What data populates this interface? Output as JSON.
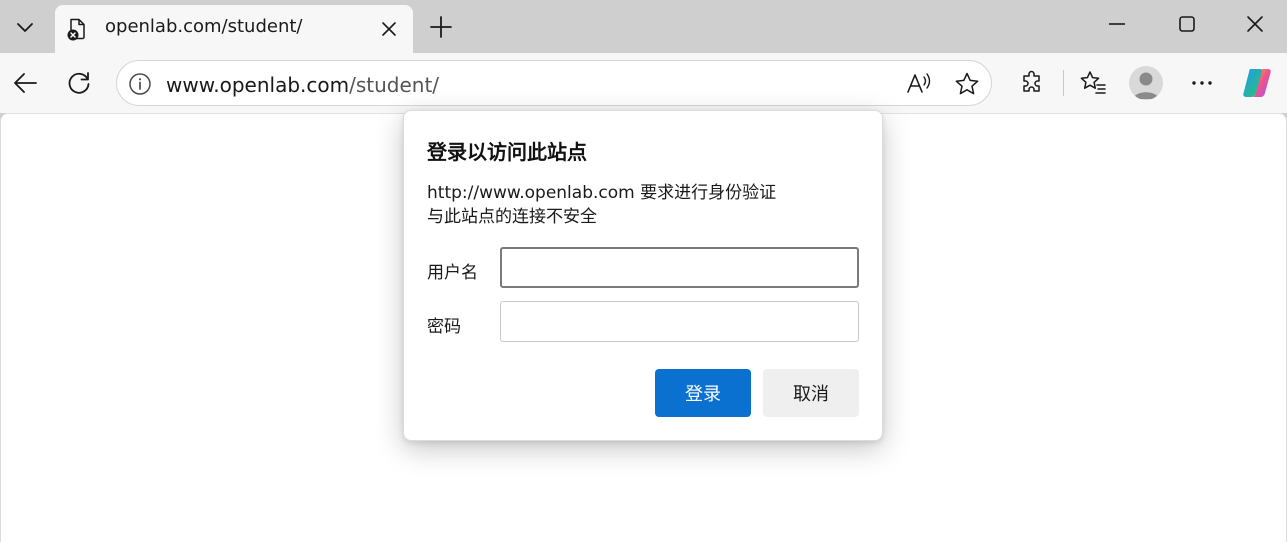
{
  "tab": {
    "title": "openlab.com/student/",
    "favicon": "page-error-icon"
  },
  "address": {
    "domain": "www.openlab.com",
    "path": "/student/"
  },
  "dialog": {
    "title": "登录以访问此站点",
    "message_line1": "http://www.openlab.com 要求进行身份验证",
    "message_line2": "与此站点的连接不安全",
    "username_label": "用户名",
    "username_value": "",
    "password_label": "密码",
    "password_value": "",
    "login_button": "登录",
    "cancel_button": "取消"
  },
  "colors": {
    "primary_button": "#0b71d0",
    "tabstrip": "#cfcfcf",
    "toolbar": "#f7f7f7"
  }
}
